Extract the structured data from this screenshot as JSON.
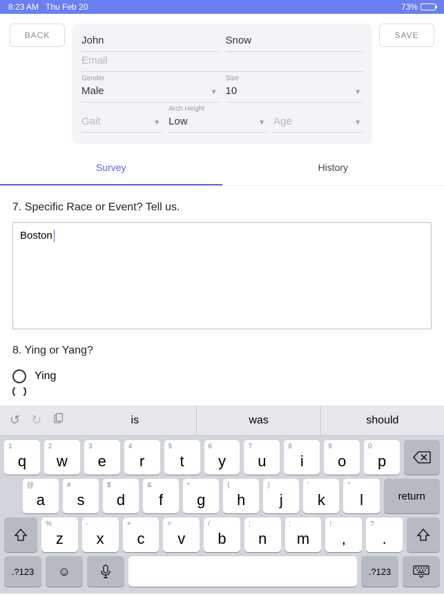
{
  "status": {
    "time": "8:23 AM",
    "date": "Thu Feb 20",
    "battery_pct": "73%"
  },
  "header": {
    "back": "BACK",
    "save": "SAVE"
  },
  "form": {
    "first_name": "John",
    "last_name": "Snow",
    "email_placeholder": "Email",
    "gender_label": "Gender",
    "gender": "Male",
    "size_label": "Size",
    "size": "10",
    "gait_placeholder": "Gait",
    "arch_label": "Arch Height",
    "arch": "Low",
    "age_placeholder": "Age"
  },
  "tabs": {
    "survey": "Survey",
    "history": "History"
  },
  "q7": {
    "text": "7. Specific Race or Event? Tell us.",
    "answer": "Boston"
  },
  "q8": {
    "text": "8. Ying or Yang?",
    "opt1": "Ying"
  },
  "keyboard": {
    "suggestions": [
      "is",
      "was",
      "should"
    ],
    "row1": [
      {
        "s": "1",
        "m": "q"
      },
      {
        "s": "2",
        "m": "w"
      },
      {
        "s": "3",
        "m": "e"
      },
      {
        "s": "4",
        "m": "r"
      },
      {
        "s": "5",
        "m": "t"
      },
      {
        "s": "6",
        "m": "y"
      },
      {
        "s": "7",
        "m": "u"
      },
      {
        "s": "8",
        "m": "i"
      },
      {
        "s": "9",
        "m": "o"
      },
      {
        "s": "0",
        "m": "p"
      }
    ],
    "row2": [
      {
        "s": "@",
        "m": "a"
      },
      {
        "s": "#",
        "m": "s"
      },
      {
        "s": "$",
        "m": "d"
      },
      {
        "s": "&",
        "m": "f"
      },
      {
        "s": "*",
        "m": "g"
      },
      {
        "s": "(",
        "m": "h"
      },
      {
        "s": ")",
        "m": "j"
      },
      {
        "s": "'",
        "m": "k"
      },
      {
        "s": "\"",
        "m": "l"
      }
    ],
    "row3": [
      {
        "s": "%",
        "m": "z"
      },
      {
        "s": "-",
        "m": "x"
      },
      {
        "s": "+",
        "m": "c"
      },
      {
        "s": "=",
        "m": "v"
      },
      {
        "s": "/",
        "m": "b"
      },
      {
        "s": ";",
        "m": "n"
      },
      {
        "s": ":",
        "m": "m"
      },
      {
        "s": "!",
        "m": ","
      },
      {
        "s": "?",
        "m": "."
      }
    ],
    "return": "return",
    "numkey": ".?123"
  }
}
